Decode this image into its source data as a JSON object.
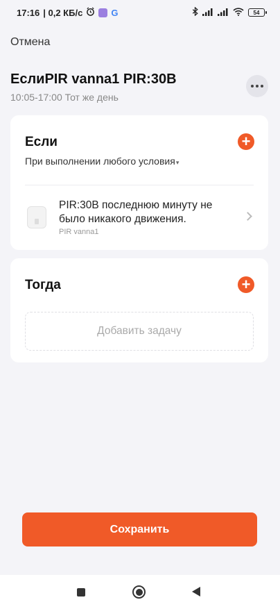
{
  "status_bar": {
    "time": "17:16",
    "speed": "| 0,2 КБ/с",
    "battery": "54",
    "icons": [
      "alarm-icon",
      "app-icon",
      "google-icon",
      "bluetooth-icon",
      "signal-icon",
      "signal-icon",
      "wifi-icon",
      "battery-icon"
    ]
  },
  "header": {
    "cancel_label": "Отмена",
    "title": "ЕслиPIR vanna1 PIR:30B",
    "subtitle": "10:05-17:00 Тот же день"
  },
  "if_section": {
    "heading": "Если",
    "condition_mode": "При выполнении любого условия",
    "condition": {
      "text": "PIR:30B последнюю минуту не было никакого движения.",
      "device": "PIR vanna1"
    }
  },
  "then_section": {
    "heading": "Тогда",
    "add_task_label": "Добавить задачу"
  },
  "save_label": "Сохранить",
  "colors": {
    "accent": "#f05a28",
    "background": "#f4f4f8"
  }
}
